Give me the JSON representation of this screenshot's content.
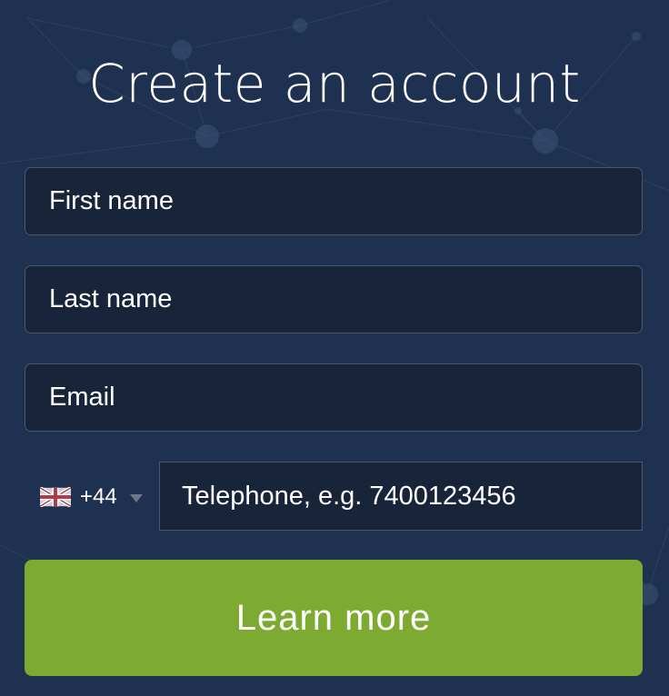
{
  "form": {
    "title": "Create an account",
    "first_name_placeholder": "First name",
    "last_name_placeholder": "Last name",
    "email_placeholder": "Email",
    "country_code": "+44",
    "country_flag": "uk-flag-icon",
    "telephone_placeholder": "Telephone, e.g. 7400123456",
    "submit_label": "Learn more"
  },
  "colors": {
    "background": "#1e3150",
    "field_background": "#172439",
    "field_border": "#4b5668",
    "button": "#7dab32",
    "text": "#ffffff"
  }
}
